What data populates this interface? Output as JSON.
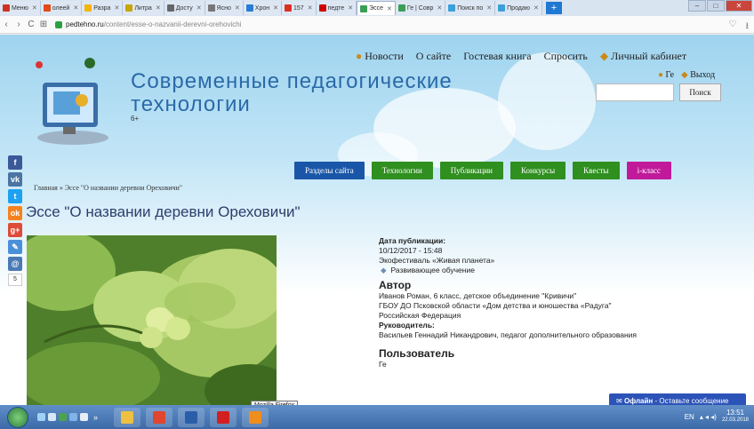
{
  "browser": {
    "tabs": [
      {
        "label": "Меню",
        "color": "#cc3322"
      },
      {
        "label": "олеей",
        "color": "#e04b1a"
      },
      {
        "label": "Разра",
        "color": "#f5b400"
      },
      {
        "label": "Литра",
        "color": "#c8a500"
      },
      {
        "label": "Досту",
        "color": "#666666"
      },
      {
        "label": "Ясно",
        "color": "#777777"
      },
      {
        "label": "Хрон",
        "color": "#2a7bd4"
      },
      {
        "label": "157",
        "color": "#d93025"
      },
      {
        "label": "педте",
        "color": "#cc0000"
      },
      {
        "label": "Эссе",
        "color": "#3a9e55",
        "active": true
      },
      {
        "label": "Ге | Совр",
        "color": "#3a9e55"
      },
      {
        "label": "Поиск по",
        "color": "#3aa0d8"
      },
      {
        "label": "Продаю",
        "color": "#3aa0d8"
      }
    ],
    "url_host": "pedtehno.ru",
    "url_path": "/content/esse-o-nazvanii-derevni-orehovichi",
    "nav": {
      "back": "‹",
      "forward": "›",
      "reload": "C",
      "apps": "⊞"
    },
    "window": {
      "minimize": "–",
      "maximize": "□",
      "close": "✕"
    },
    "new_tab": "+",
    "tab_close": "✕",
    "addr_icons": {
      "heart": "♡",
      "download": "⭳"
    }
  },
  "header": {
    "top_links": [
      "Новости",
      "О сайте",
      "Гостевая книга",
      "Спросить",
      "Личный кабинет"
    ],
    "title_line1": "Современные педагогические",
    "title_line2": "технологии",
    "age": "6+",
    "user_name": "Ге",
    "logout": "Выход",
    "search_button": "Поиск"
  },
  "menu": [
    {
      "label": "Разделы сайта",
      "color": "#1a56a8"
    },
    {
      "label": "Технологии",
      "color": "#2f8f1f"
    },
    {
      "label": "Публикации",
      "color": "#2f8f1f"
    },
    {
      "label": "Конкурсы",
      "color": "#2f8f1f"
    },
    {
      "label": "Квесты",
      "color": "#2f8f1f"
    },
    {
      "label": "i-класс",
      "color": "#c01a9a"
    }
  ],
  "social": [
    {
      "name": "facebook",
      "glyph": "f",
      "color": "#3b5998"
    },
    {
      "name": "vk",
      "glyph": "vk",
      "color": "#4c75a3"
    },
    {
      "name": "twitter",
      "glyph": "t",
      "color": "#1da1f2"
    },
    {
      "name": "odnoklassniki",
      "glyph": "ok",
      "color": "#f58220"
    },
    {
      "name": "google-plus",
      "glyph": "g+",
      "color": "#dd4b39"
    },
    {
      "name": "livejournal",
      "glyph": "✎",
      "color": "#4a90d9"
    },
    {
      "name": "email",
      "glyph": "@",
      "color": "#4a7ab5"
    }
  ],
  "social_count": "5",
  "breadcrumb": "Главная » Эссе \"О названии деревни Ореховичи\"",
  "article": {
    "title": "Эссе \"О названии деревни Ореховичи\"",
    "pub_label": "Дата публикации:",
    "pub_date": "10/12/2017 - 15:48",
    "festival": "Экофестиваль «Живая планета»",
    "tag": "Развивающее обучение",
    "author_heading": "Автор",
    "author_name": "Иванов Роман, 6 класс, детское объединение \"Кривичи\"",
    "author_org": "ГБОУ ДО Псковской области «Дом детства и юношества «Радуга\"",
    "author_country": "Российская Федерация",
    "supervisor_label": "Руководитель:",
    "supervisor": "Васильев Геннадий Никандрович, педагог дополнительного образования",
    "user_heading": "Пользователь",
    "user": "Ге"
  },
  "online_chat": {
    "status": "Офлайн",
    "text": " - Оставьте сообщение"
  },
  "tooltip": "Mozilla Firefox",
  "taskbar": {
    "lang": "EN",
    "time": "13:51",
    "date": "22.03.2018",
    "expand": "»",
    "tray_icons": "▴ ◂ ◂)",
    "apps": [
      {
        "name": "explorer",
        "color": "#f0c040"
      },
      {
        "name": "chrome",
        "color": "#e0452e"
      },
      {
        "name": "word",
        "color": "#2b5ea8"
      },
      {
        "name": "opera",
        "color": "#d21f1f"
      },
      {
        "name": "firefox",
        "color": "#f08d1c"
      }
    ]
  }
}
